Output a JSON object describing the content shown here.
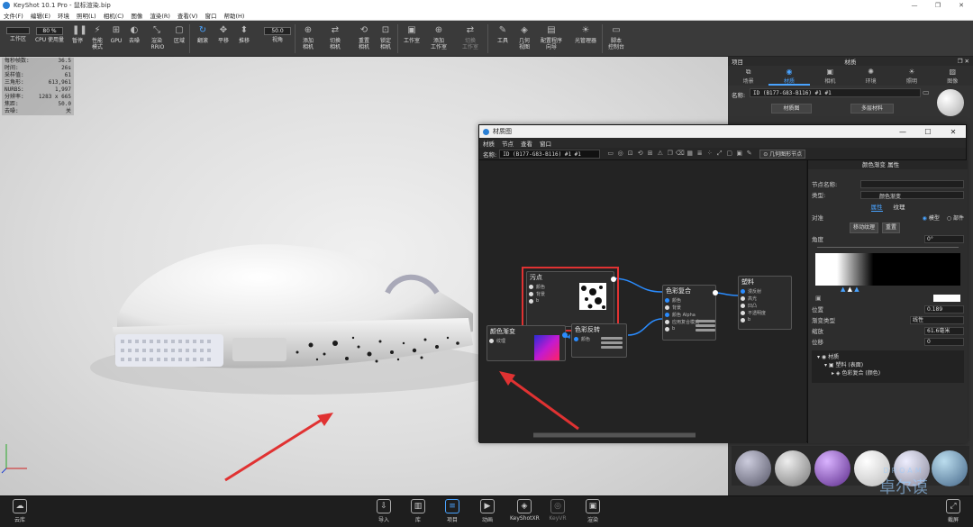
{
  "window": {
    "title": "KeyShot 10.1 Pro - 鼠标渲染.bip",
    "controls": [
      "—",
      "❐",
      "✕"
    ]
  },
  "menu": [
    "文件(F)",
    "编辑(E)",
    "环境",
    "照明(L)",
    "相机(C)",
    "图像",
    "渲染(R)",
    "查看(V)",
    "窗口",
    "帮助(H)"
  ],
  "toolbar": {
    "items": [
      {
        "label": "工作区",
        "icon": "workspace-icon"
      },
      {
        "label": "CPU 使用量",
        "icon": "cpu-icon",
        "value": "80 %"
      },
      {
        "label": "暂停",
        "icon": "pause-icon"
      },
      {
        "label": "性能\n模式",
        "icon": "performance-icon"
      },
      {
        "label": "GPU",
        "icon": "gpu-icon"
      },
      {
        "label": "去噪",
        "icon": "denoise-icon"
      },
      {
        "label": "渲染\n RRIO",
        "icon": "render-region-icon"
      },
      {
        "label": "区域",
        "icon": "region-icon"
      },
      {
        "label": "翻滚",
        "icon": "tumble-icon"
      },
      {
        "label": "平移",
        "icon": "pan-icon"
      },
      {
        "label": "推移",
        "icon": "dolly-icon"
      },
      {
        "label": "视角",
        "icon": "fov-icon",
        "value": "50.0"
      },
      {
        "label": "添加\n相机",
        "icon": "add-camera-icon"
      },
      {
        "label": "切换\n相机",
        "icon": "switch-camera-icon"
      },
      {
        "label": "重置\n相机",
        "icon": "reset-camera-icon"
      },
      {
        "label": "锁定\n相机",
        "icon": "lock-camera-icon"
      },
      {
        "label": "工作室",
        "icon": "studio-icon"
      },
      {
        "label": "添加\n工作室",
        "icon": "add-studio-icon"
      },
      {
        "label": "切换\n工作室",
        "icon": "switch-studio-icon"
      },
      {
        "label": "工具",
        "icon": "tools-icon"
      },
      {
        "label": "几何\n视图",
        "icon": "geometry-view-icon"
      },
      {
        "label": "配置程序\n向导",
        "icon": "configurator-icon"
      },
      {
        "label": "光管理器",
        "icon": "light-manager-icon"
      },
      {
        "label": "脚本\n控制台",
        "icon": "script-console-icon"
      }
    ]
  },
  "stats": [
    {
      "k": "每秒帧数:",
      "v": "36.5"
    },
    {
      "k": "时间:",
      "v": "26s"
    },
    {
      "k": "采样值:",
      "v": "61"
    },
    {
      "k": "三角形:",
      "v": "613,961"
    },
    {
      "k": "NURBS:",
      "v": "1,997"
    },
    {
      "k": "分辨率:",
      "v": "1283 x 665"
    },
    {
      "k": "焦距:",
      "v": "50.0"
    },
    {
      "k": "去噪:",
      "v": "关"
    }
  ],
  "right_panel": {
    "left_header": "项目",
    "right_header": "材质",
    "tabs": [
      {
        "label": "场景",
        "icon": "scene-icon"
      },
      {
        "label": "材质",
        "icon": "material-icon",
        "active": true
      },
      {
        "label": "相机",
        "icon": "camera-icon"
      },
      {
        "label": "环境",
        "icon": "environment-icon"
      },
      {
        "label": "照明",
        "icon": "lighting-icon"
      },
      {
        "label": "图像",
        "icon": "image-icon"
      }
    ],
    "name_label": "名称:",
    "name_value": "ID (B177-G83-B116) #1 #1",
    "material_graph_button": "材质图",
    "multi_material_button": "多层材料"
  },
  "material_window": {
    "title": "材质图",
    "menu": [
      "材质",
      "节点",
      "查看",
      "窗口"
    ],
    "name_label": "名称:",
    "name_value": "ID (B177-G83-B116) #1 #1",
    "geometry_node_button": "几何图形节点",
    "nodes": {
      "spots": {
        "title": "污点",
        "ports": [
          "颜色",
          "背景",
          "b"
        ]
      },
      "gradient": {
        "title": "颜色渐变",
        "ports": [
          "纹理"
        ]
      },
      "color_invert": {
        "title": "色彩反转",
        "ports": [
          "颜色"
        ]
      },
      "color_composite": {
        "title": "色彩复合",
        "ports": [
          "颜色",
          "背景",
          "颜色 Alpha",
          "应用复合模式",
          "b"
        ]
      },
      "plastic": {
        "title": "塑料",
        "ports": [
          "漫反射",
          "高光",
          "凹凸",
          "不透明度",
          "b"
        ]
      }
    },
    "props": {
      "header": "颜色渐变 属性",
      "node_name_label": "节点名称:",
      "type_label": "类型:",
      "type_value": "颜色渐变",
      "tab_properties": "属性",
      "tab_texture": "纹理",
      "source_label": "对准",
      "mode_model": "模型",
      "mode_part": "部件",
      "move_texture": "移动纹理",
      "reset": "重置",
      "angle_label": "角度",
      "angle_value": "0°",
      "position_label": "位置",
      "position_value": "0.189",
      "gradient_type_label": "渐变类型",
      "gradient_type_value": "线性",
      "scale_label": "缩放",
      "scale_value": "61.6毫米",
      "offset_label": "位移",
      "offset_value": "0",
      "tree": [
        "材质",
        "塑料 (表面)",
        "色彩复合 (颜色)"
      ]
    }
  },
  "bottom_bar": [
    {
      "label": "云库",
      "icon": "cloud-library-icon"
    },
    {
      "label": "导入",
      "icon": "import-icon"
    },
    {
      "label": "库",
      "icon": "library-icon"
    },
    {
      "label": "项目",
      "icon": "project-icon",
      "active": true
    },
    {
      "label": "动画",
      "icon": "animation-icon"
    },
    {
      "label": "KeyShotXR",
      "icon": "keyshotxr-icon"
    },
    {
      "label": "KeyVR",
      "icon": "keyvr-icon"
    },
    {
      "label": "渲染",
      "icon": "render-icon"
    },
    {
      "label": "截屏",
      "icon": "screenshot-icon"
    }
  ],
  "watermark": "卓尔谟",
  "watermark_sub": "DROAM",
  "accent": "#49a3ff",
  "highlight_color": "#e03232"
}
